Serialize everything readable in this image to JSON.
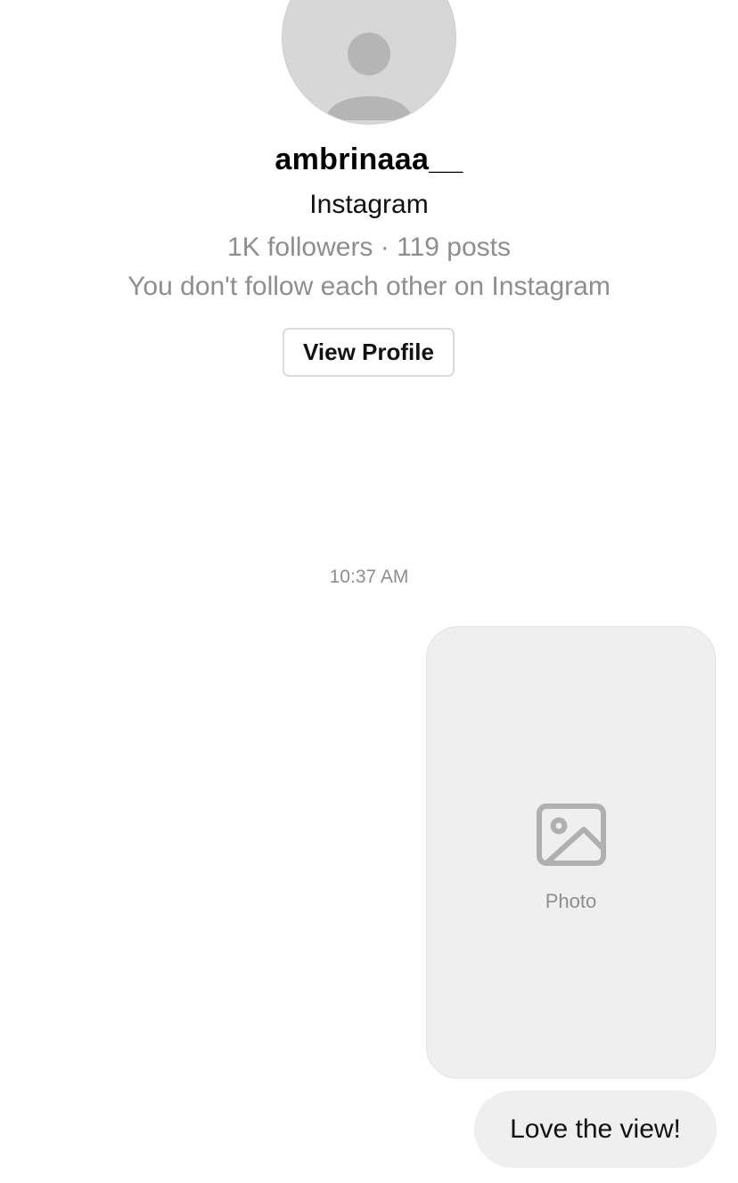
{
  "profile": {
    "username": "ambrinaaa__",
    "platform": "Instagram",
    "stats": "1K followers · 119 posts",
    "follow_note": "You don't follow each other on Instagram",
    "view_profile_label": "View Profile",
    "avatar_icon": "person-silhouette-icon"
  },
  "thread": {
    "timestamp": "10:37 AM",
    "messages": [
      {
        "type": "photo",
        "placeholder_label": "Photo",
        "icon": "image-icon"
      },
      {
        "type": "text",
        "text": "Love the view!"
      }
    ]
  },
  "colors": {
    "secondary_text": "#8e8e8e",
    "bubble_bg": "#efefef",
    "button_border": "#dbdbdb"
  }
}
